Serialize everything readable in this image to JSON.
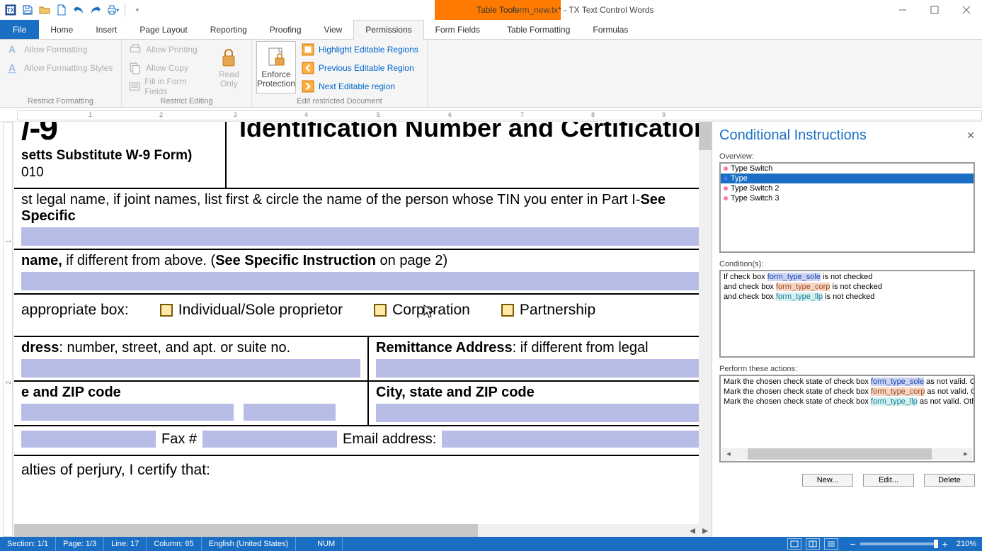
{
  "window": {
    "title": "form_new.tx* - TX Text Control Words",
    "context_tab_group": "Table Tools"
  },
  "qat": {
    "save": "save",
    "open": "open",
    "new": "new",
    "undo": "undo",
    "redo": "redo",
    "print": "print"
  },
  "ribbon": {
    "file": "File",
    "tabs": [
      "Home",
      "Insert",
      "Page Layout",
      "Reporting",
      "Proofing",
      "View",
      "Permissions",
      "Form Fields",
      "Table Formatting",
      "Formulas"
    ],
    "active_tab": "Permissions",
    "groups": {
      "restrict_formatting": {
        "label": "Restrict Formatting",
        "allow_formatting": "Allow Formatting",
        "allow_formatting_styles": "Allow Formatting Styles"
      },
      "restrict_editing": {
        "label": "Restrict Editing",
        "allow_printing": "Allow Printing",
        "allow_copy": "Allow Copy",
        "fill_in_form_fields": "Fill in Form Fields",
        "read_only": "Read\nOnly"
      },
      "edit_restricted": {
        "label": "Edit restricted Document",
        "enforce_protection": "Enforce\nProtection",
        "highlight_editable": "Highlight Editable Regions",
        "previous_editable": "Previous Editable Region",
        "next_editable": "Next Editable region"
      }
    }
  },
  "document": {
    "header_left_big": "/-9",
    "header_left_sub": "setts Substitute W-9 Form)",
    "header_left_year": "010",
    "header_right_title": "Identification Number and Certification",
    "legal_name_row": "st legal name, if joint names, list first & circle the name of the person whose TIN you enter in Part I-",
    "legal_name_bold": "See Specific",
    "business_name_prefix_bold": "name,",
    "business_name_rest": " if different from above. (",
    "business_name_bold2": "See Specific Instruction",
    "business_name_tail": " on page 2)",
    "check_line_label": " appropriate box:",
    "check1": "Individual/Sole proprietor",
    "check2": "Corporation",
    "check3": "Partnership",
    "addr_left_bold": "dress",
    "addr_left_rest": ": number, street, and apt. or suite no.",
    "addr_right_bold": "Remittance Address",
    "addr_right_rest": ": if different from legal",
    "zip_left_bold": "e and ZIP code",
    "zip_right_bold": "City, state and ZIP code",
    "fax_label": "Fax #",
    "email_label": "Email address:",
    "perjury": "alties of perjury, I certify that:"
  },
  "taskpane": {
    "title": "Conditional Instructions",
    "overview_label": "Overview:",
    "overview_items": [
      "Type Switch",
      "Type",
      "Type Switch 2",
      "Type Switch 3"
    ],
    "overview_selected_index": 1,
    "conditions_label": "Condition(s):",
    "cond_line1_pre": "If check box ",
    "cond_line1_ref": "form_type_sole",
    "cond_line1_post": " is not checked",
    "cond_line2_pre": "and check box ",
    "cond_line2_ref": "form_type_corp",
    "cond_line2_post": " is not checked",
    "cond_line3_pre": "and check box ",
    "cond_line3_ref": "form_type_llp",
    "cond_line3_post": " is not checked",
    "actions_label": "Perform these actions:",
    "act_pre": "Mark the chosen check state of check box ",
    "act1_ref": "form_type_sole",
    "act1_post": " as not valid. Oth",
    "act2_ref": "form_type_corp",
    "act2_post": " as not valid. Oth",
    "act3_ref": "form_type_llp",
    "act3_post": " as not valid. Other",
    "btn_new": "New...",
    "btn_edit": "Edit...",
    "btn_delete": "Delete"
  },
  "statusbar": {
    "section": "Section: 1/1",
    "page": "Page: 1/3",
    "line": "Line: 17",
    "column": "Column: 65",
    "language": "English (United States)",
    "num": "NUM",
    "zoom": "210%"
  },
  "ruler_marks": [
    "1",
    "2",
    "3",
    "4",
    "5",
    "6",
    "7",
    "8",
    "9"
  ]
}
